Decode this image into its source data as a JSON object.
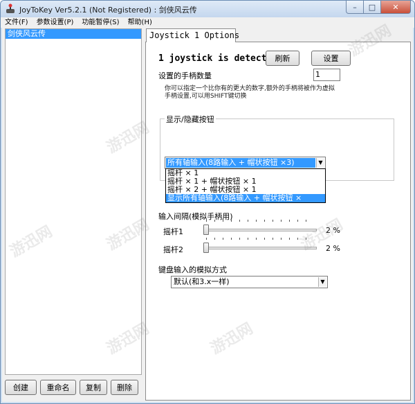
{
  "window": {
    "title": "JoyToKey Ver5.2.1 (Not Registered) : 剑侠风云传",
    "minimize_glyph": "–",
    "maximize_glyph": "□",
    "close_glyph": "✕",
    "app_icon": "joystick-icon"
  },
  "menu": [
    "文件(F)",
    "参数设置(P)",
    "功能暂停(S)",
    "帮助(H)"
  ],
  "sidebar": {
    "configs": [
      "剑侠风云传"
    ],
    "buttons": [
      "创建",
      "重命名",
      "复制",
      "删除"
    ]
  },
  "tabs": [
    "Joystick 1",
    "Options"
  ],
  "options": {
    "detected_text": "1 joystick is detected",
    "refresh_label": "刷新",
    "settings_label": "设置",
    "count_label": "设置的手柄数量",
    "count_value": "1",
    "note_line1": "你可以指定一个比你有的更大的数字,额外的手柄将被作为虚拟",
    "note_line2": "手柄设置,可以用SHIFT键切换",
    "show_hide_title": "显示/隐藏按钮",
    "combo_selected": "所有轴输入(8路输入 + 帽状按钮 ×3)",
    "dropdown_options": [
      "摇杆 × 1",
      "摇杆 × 1 + 帽状按钮 × 1",
      "摇杆 × 2 + 帽状按钮 × 1",
      "显示所有轴输入(8路输入 + 帽状按钮 ×"
    ],
    "interval_title": "输入间隔(模拟手柄用)",
    "sliders": [
      {
        "label": "摇杆1",
        "value": "2 %",
        "fraction": 0.0
      },
      {
        "label": "摇杆2",
        "value": "2 %",
        "fraction": 0.0
      }
    ],
    "keyboard_title": "键盘输入的模拟方式",
    "keyboard_selected": "默认(和3.x一样)"
  },
  "watermark_text": "游迅网",
  "colors": {
    "selection": "#3399ff",
    "titlebar": "#c4d7ee",
    "close": "#c9503a"
  }
}
